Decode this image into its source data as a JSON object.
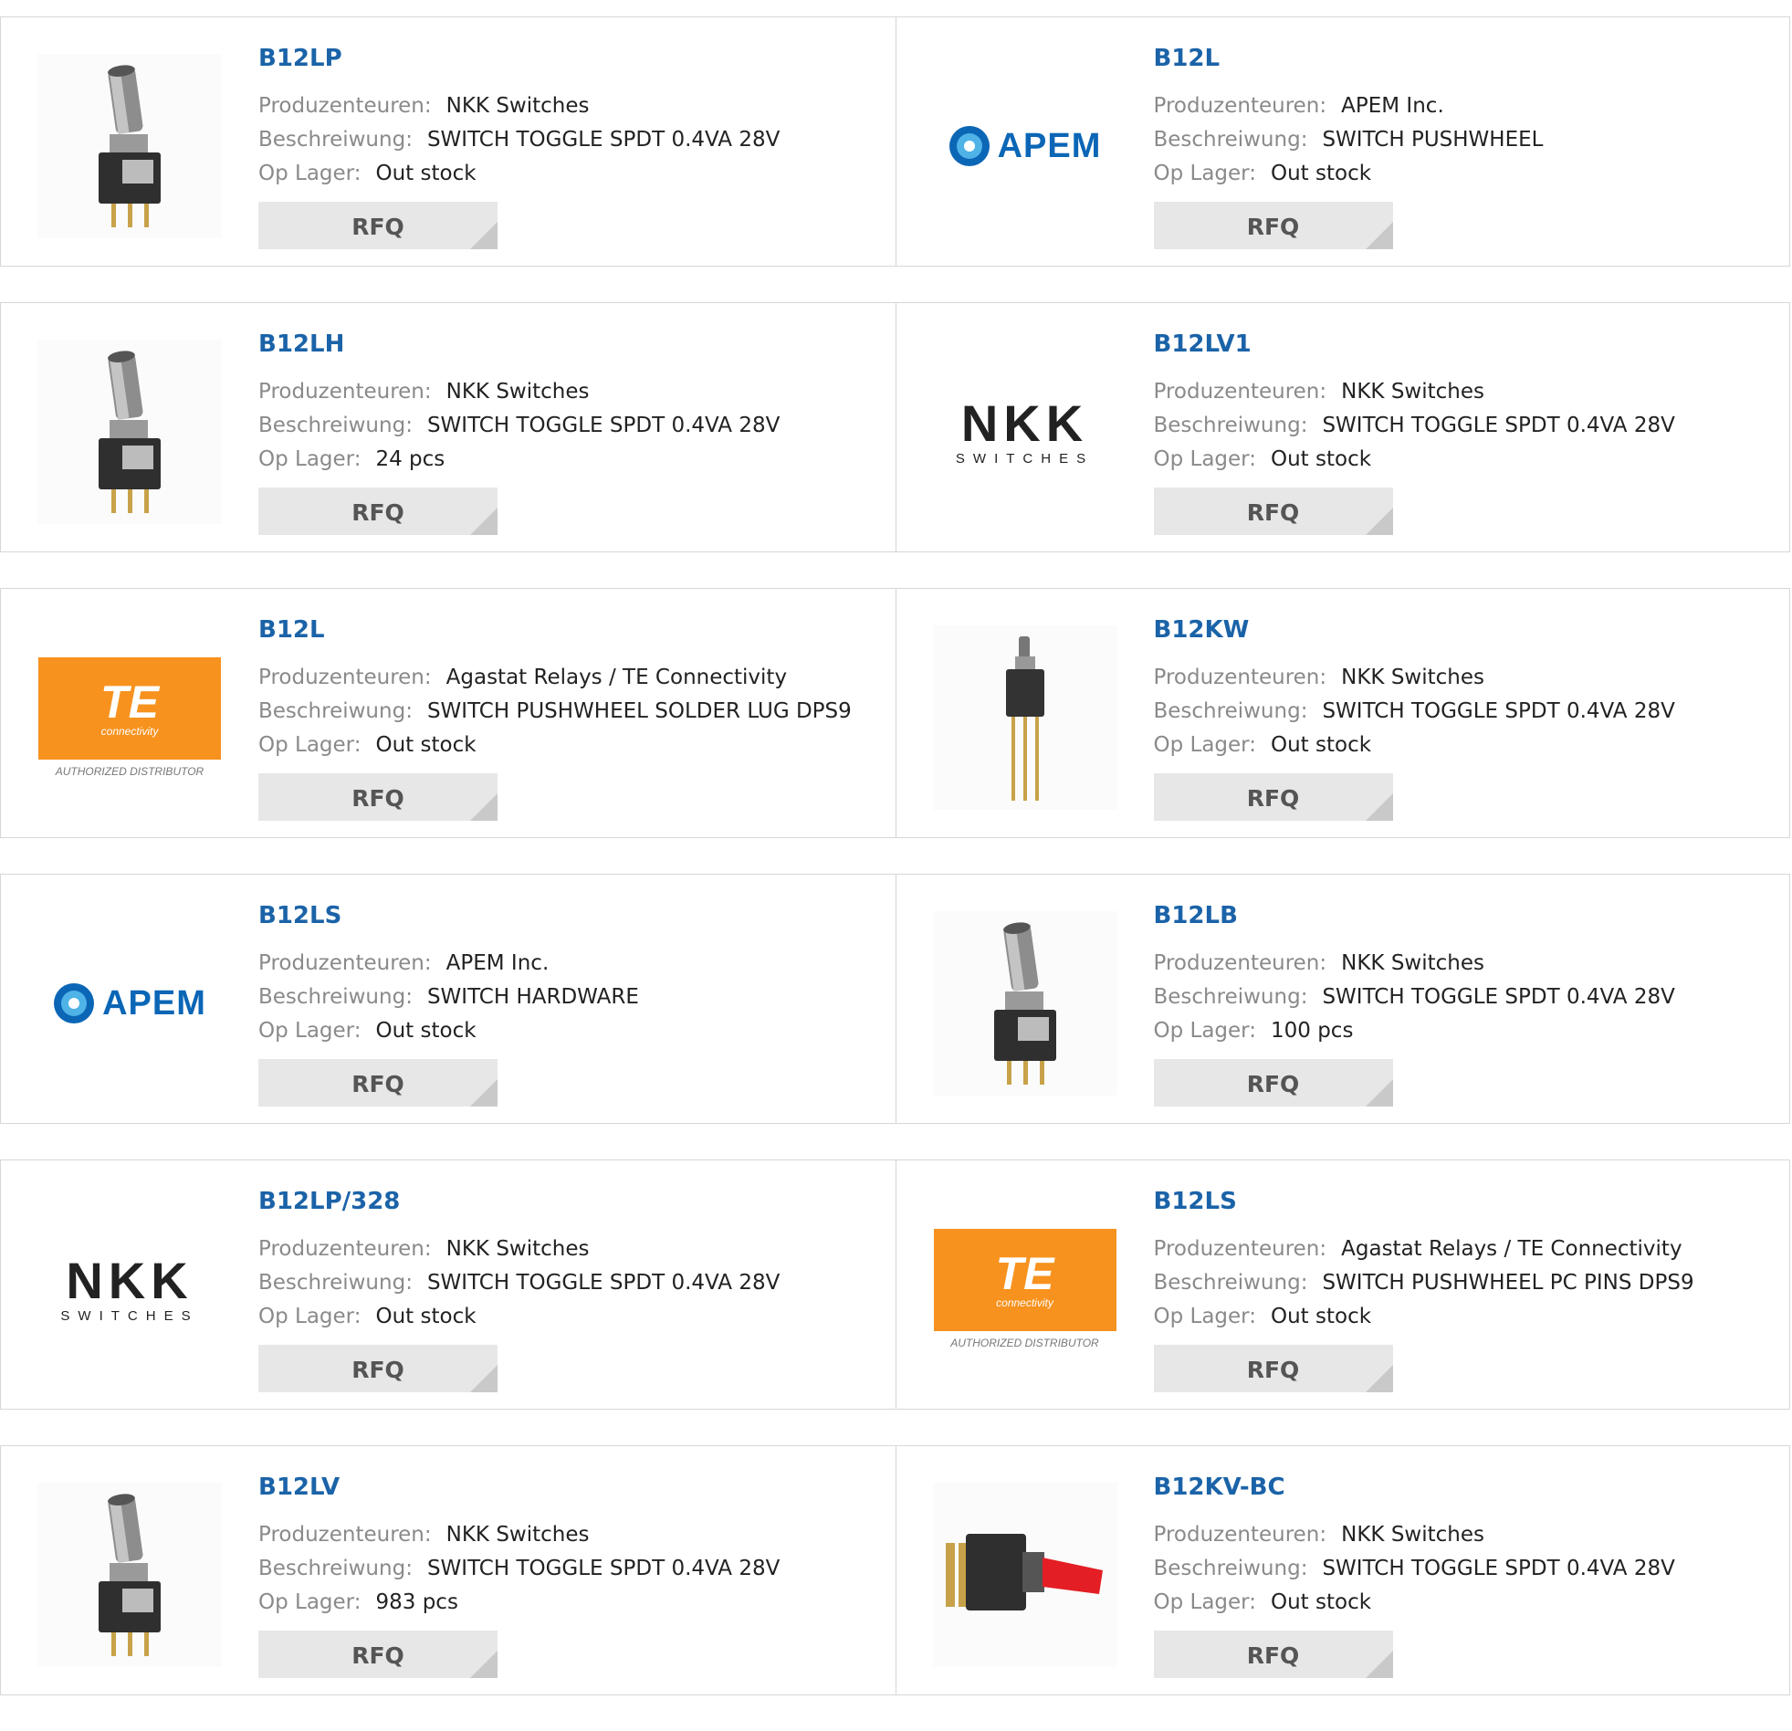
{
  "labels": {
    "manufacturer": "Produzenteuren:",
    "description": "Beschreiwung:",
    "stock": "Op Lager:",
    "rfq": "RFQ"
  },
  "colors": {
    "link_blue": "#1b63a8",
    "apem_blue": "#0b66b6",
    "te_orange": "#f7921e",
    "nkk_red": "#d2232a",
    "button_gray": "#e7e7e7"
  },
  "logo_text": {
    "apem": "APEM",
    "nkk_top": "NKK",
    "nkk_sub": "SWITCHES",
    "te": "TE",
    "te_sub": "connectivity",
    "te_caption": "AUTHORIZED DISTRIBUTOR"
  },
  "products": [
    {
      "pn": "B12LP",
      "manufacturer": "NKK Switches",
      "description": "SWITCH TOGGLE SPDT 0.4VA 28V",
      "stock": "Out stock",
      "image": "toggle-tall"
    },
    {
      "pn": "B12L",
      "manufacturer": "APEM Inc.",
      "description": "SWITCH PUSHWHEEL",
      "stock": "Out stock",
      "image": "apem-logo"
    },
    {
      "pn": "B12LH",
      "manufacturer": "NKK Switches",
      "description": "SWITCH TOGGLE SPDT 0.4VA 28V",
      "stock": "24 pcs",
      "image": "toggle-tall"
    },
    {
      "pn": "B12LV1",
      "manufacturer": "NKK Switches",
      "description": "SWITCH TOGGLE SPDT 0.4VA 28V",
      "stock": "Out stock",
      "image": "nkk-logo"
    },
    {
      "pn": "B12L",
      "manufacturer": "Agastat Relays / TE Connectivity",
      "description": "SWITCH PUSHWHEEL SOLDER LUG DPS9",
      "stock": "Out stock",
      "image": "te-logo"
    },
    {
      "pn": "B12KW",
      "manufacturer": "NKK Switches",
      "description": "SWITCH TOGGLE SPDT 0.4VA 28V",
      "stock": "Out stock",
      "image": "toggle-small"
    },
    {
      "pn": "B12LS",
      "manufacturer": "APEM Inc.",
      "description": "SWITCH HARDWARE",
      "stock": "Out stock",
      "image": "apem-logo"
    },
    {
      "pn": "B12LB",
      "manufacturer": "NKK Switches",
      "description": "SWITCH TOGGLE SPDT 0.4VA 28V",
      "stock": "100 pcs",
      "image": "toggle-tall"
    },
    {
      "pn": "B12LP/328",
      "manufacturer": "NKK Switches",
      "description": "SWITCH TOGGLE SPDT 0.4VA 28V",
      "stock": "Out stock",
      "image": "nkk-logo"
    },
    {
      "pn": "B12LS",
      "manufacturer": "Agastat Relays / TE Connectivity",
      "description": "SWITCH PUSHWHEEL PC PINS DPS9",
      "stock": "Out stock",
      "image": "te-logo"
    },
    {
      "pn": "B12LV",
      "manufacturer": "NKK Switches",
      "description": "SWITCH TOGGLE SPDT 0.4VA 28V",
      "stock": "983 pcs",
      "image": "toggle-tall"
    },
    {
      "pn": "B12KV-BC",
      "manufacturer": "NKK Switches",
      "description": "SWITCH TOGGLE SPDT 0.4VA 28V",
      "stock": "Out stock",
      "image": "toggle-red"
    }
  ]
}
